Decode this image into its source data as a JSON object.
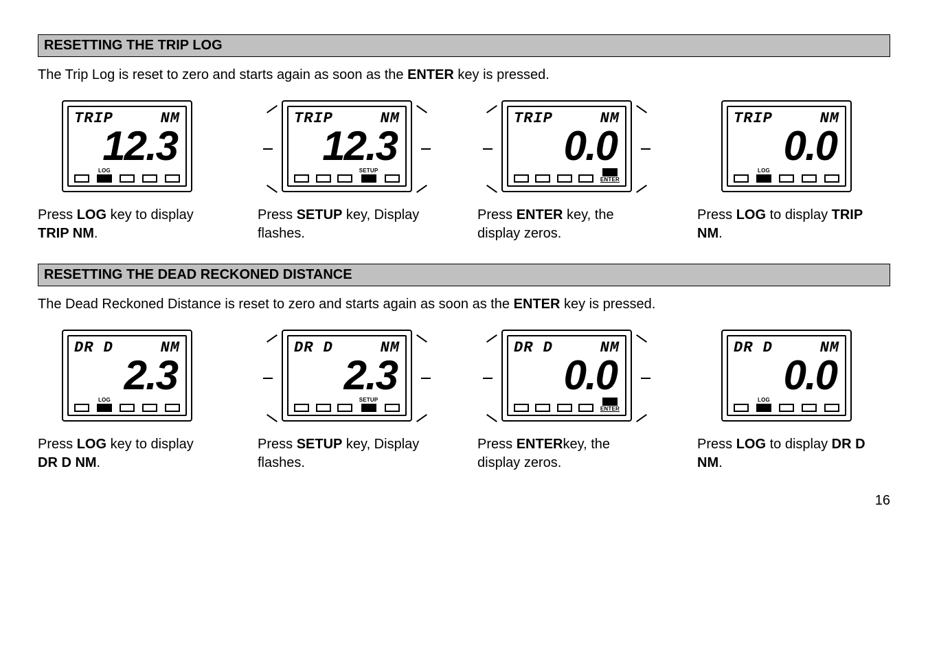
{
  "section1": {
    "heading": "RESETTING THE TRIP LOG",
    "intro_pre": "The Trip Log is reset to zero and starts again as soon as the ",
    "intro_bold": "ENTER",
    "intro_post": " key is pressed."
  },
  "section2": {
    "heading": "RESETTING THE DEAD RECKONED DISTANCE",
    "intro_pre": "The Dead Reckoned Distance is reset to zero and starts again as soon as the ",
    "intro_bold": "ENTER",
    "intro_post": " key is pressed."
  },
  "row1": {
    "d1": {
      "topL": "TRIP",
      "topR": "NM",
      "big": "12.3",
      "activeBtn": 2,
      "label": "LOG",
      "labelPos": "above",
      "flash": false
    },
    "d2": {
      "topL": "TRIP",
      "topR": "NM",
      "big": "12.3",
      "activeBtn": 4,
      "label": "SETUP",
      "labelPos": "above",
      "flash": true
    },
    "d3": {
      "topL": "TRIP",
      "topR": "NM",
      "big": "0.0",
      "activeBtn": 5,
      "label": "ENTER",
      "labelPos": "below",
      "flash": true
    },
    "d4": {
      "topL": "TRIP",
      "topR": "NM",
      "big": "0.0",
      "activeBtn": 2,
      "label": "LOG",
      "labelPos": "above",
      "flash": false
    }
  },
  "row2": {
    "d1": {
      "topL": "DR  D",
      "topR": "NM",
      "big": "2.3",
      "activeBtn": 2,
      "label": "LOG",
      "labelPos": "above",
      "flash": false
    },
    "d2": {
      "topL": "DR  D",
      "topR": "NM",
      "big": "2.3",
      "activeBtn": 4,
      "label": "SETUP",
      "labelPos": "above",
      "flash": true
    },
    "d3": {
      "topL": "DR  D",
      "topR": "NM",
      "big": "0.0",
      "activeBtn": 5,
      "label": "ENTER",
      "labelPos": "below",
      "flash": true
    },
    "d4": {
      "topL": "DR  D",
      "topR": "NM",
      "big": "0.0",
      "activeBtn": 2,
      "label": "LOG",
      "labelPos": "above",
      "flash": false
    }
  },
  "captions1": {
    "c1": {
      "pre": "Press ",
      "b1": "LOG",
      "mid": " key to display ",
      "b2": "TRIP NM",
      "post": "."
    },
    "c2": {
      "pre": "Press ",
      "b1": "SETUP",
      "mid": " key, Display flashes.",
      "b2": "",
      "post": ""
    },
    "c3": {
      "pre": "Press ",
      "b1": "ENTER",
      "mid": " key, the display zeros.",
      "b2": "",
      "post": ""
    },
    "c4": {
      "pre": "Press ",
      "b1": "LOG",
      "mid": " to display ",
      "b2": "TRIP NM",
      "post": "."
    }
  },
  "captions2": {
    "c1": {
      "pre": "Press ",
      "b1": "LOG",
      "mid": " key to display ",
      "b2": "DR D NM",
      "post": "."
    },
    "c2": {
      "pre": "Press ",
      "b1": "SETUP",
      "mid": " key, Display flashes.",
      "b2": "",
      "post": ""
    },
    "c3": {
      "pre": "Press ",
      "b1": "ENTER",
      "mid": "key, the display zeros.",
      "b2": "",
      "post": ""
    },
    "c4": {
      "pre": "Press ",
      "b1": "LOG",
      "mid": " to display ",
      "b2": "DR D NM",
      "post": "."
    }
  },
  "page_number": "16"
}
